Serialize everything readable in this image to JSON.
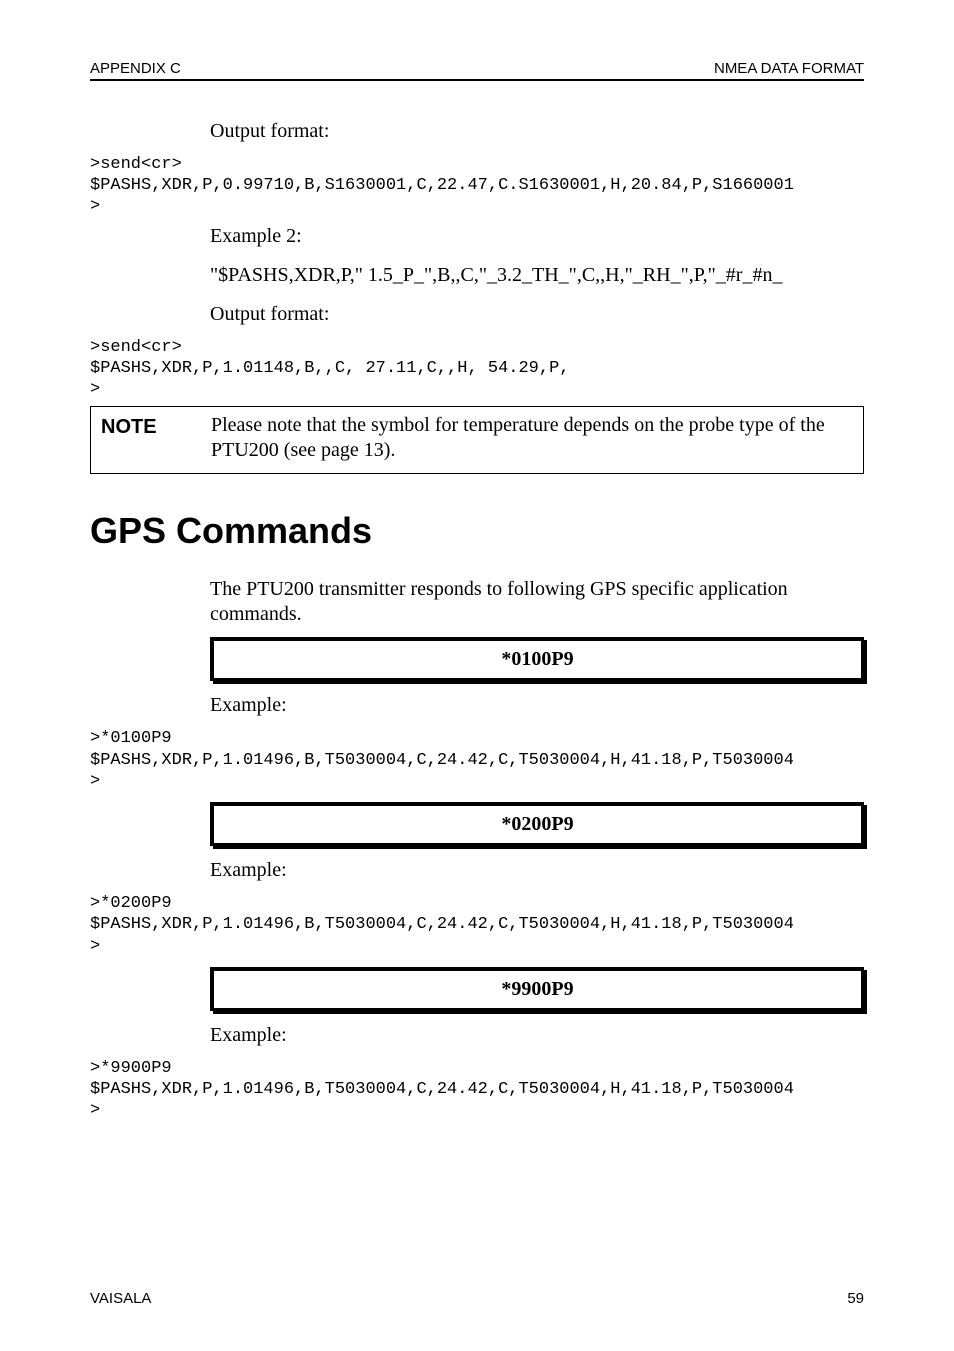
{
  "header": {
    "left": "APPENDIX C",
    "right": "NMEA DATA FORMAT"
  },
  "body": {
    "output_format_label": "Output format:",
    "example2_label": "Example 2:",
    "code1": ">send<cr>\n$PASHS,XDR,P,0.99710,B,S1630001,C,22.47,C.S1630001,H,20.84,P,S1660001\n>",
    "form_line": "\"$PASHS,XDR,P,\" 1.5_P_\",B,,C,\"_3.2_TH_\",C,,H,\"_RH_\",P,\"_#r_#n_",
    "code2": ">send<cr>\n$PASHS,XDR,P,1.01148,B,,C, 27.11,C,,H, 54.29,P,\n>"
  },
  "note": {
    "label": "NOTE",
    "text": "Please note that the symbol for temperature depends on the probe type of the PTU200 (see page 13)."
  },
  "gps": {
    "title": "GPS Commands",
    "intro": "The PTU200 transmitter responds to following GPS specific application commands.",
    "example_label": "Example:",
    "cmds": [
      {
        "code": "*0100P9",
        "example_code": ">*0100P9\n$PASHS,XDR,P,1.01496,B,T5030004,C,24.42,C,T5030004,H,41.18,P,T5030004\n>"
      },
      {
        "code": "*0200P9",
        "example_code": ">*0200P9\n$PASHS,XDR,P,1.01496,B,T5030004,C,24.42,C,T5030004,H,41.18,P,T5030004\n>"
      },
      {
        "code": "*9900P9",
        "example_code": ">*9900P9\n$PASHS,XDR,P,1.01496,B,T5030004,C,24.42,C,T5030004,H,41.18,P,T5030004\n>"
      }
    ]
  },
  "footer": {
    "left": "VAISALA",
    "right": "59"
  }
}
